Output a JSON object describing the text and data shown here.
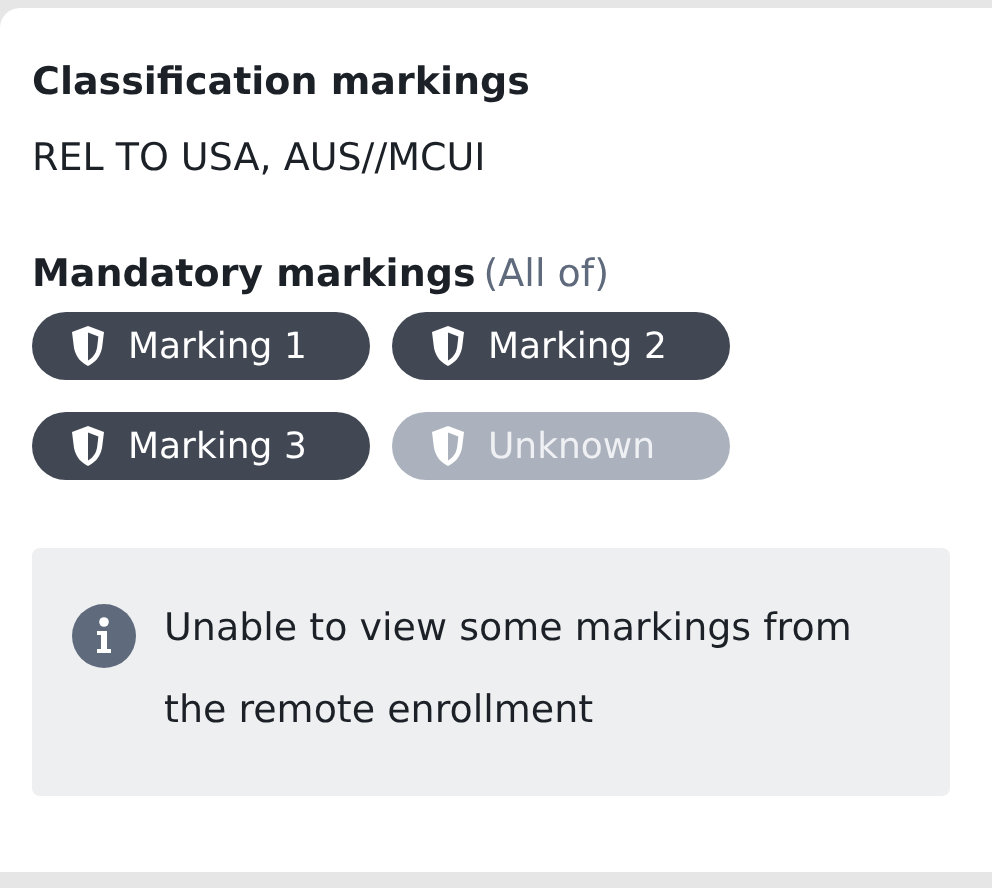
{
  "classification": {
    "heading": "Classification markings",
    "value": "REL TO USA, AUS//MCUI"
  },
  "mandatory": {
    "heading": "Mandatory markings",
    "qualifier": "(All of)",
    "markings": [
      {
        "label": "Marking 1",
        "disabled": false
      },
      {
        "label": "Marking 2",
        "disabled": false
      },
      {
        "label": "Marking 3",
        "disabled": false
      },
      {
        "label": "Unknown",
        "disabled": true
      }
    ]
  },
  "notice": {
    "text": "Unable to view some markings from the remote enrollment"
  }
}
